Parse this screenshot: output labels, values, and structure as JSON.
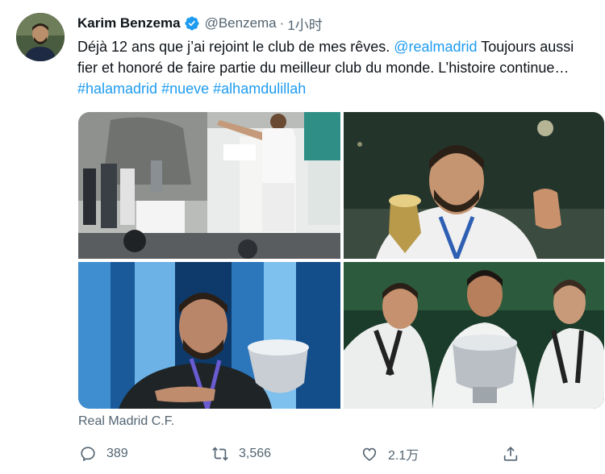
{
  "tweet": {
    "author_name": "Karim Benzema",
    "handle": "@Benzema",
    "separator": "·",
    "time": "1小时",
    "text_parts": [
      {
        "t": "Déjà 12 ans que j’ai rejoint le club de mes rêves. ",
        "link": false
      },
      {
        "t": "@realmadrid",
        "link": true
      },
      {
        "t": " Toujours aussi fier et honoré de faire partie du meilleur club du monde. L’histoire continue… ",
        "link": false
      },
      {
        "t": "#halamadrid",
        "link": true
      },
      {
        "t": " ",
        "link": false
      },
      {
        "t": "#nueve",
        "link": true
      },
      {
        "t": " ",
        "link": false
      },
      {
        "t": "#alhamdulillah",
        "link": true
      }
    ],
    "media_caption": "Real Madrid C.F.",
    "photos": [
      {
        "id": "presentation-photo"
      },
      {
        "id": "trophy-smile-photo"
      },
      {
        "id": "supercup-photo"
      },
      {
        "id": "champions-trio-photo"
      }
    ]
  },
  "actions": {
    "reply_count": "389",
    "retweet_count": "3,566",
    "like_count": "2.1万"
  },
  "colors": {
    "accent": "#1d9bf0",
    "muted": "#536471",
    "text": "#0f1419"
  },
  "icons": {
    "verified": "verified-badge-icon",
    "reply": "reply-icon",
    "retweet": "retweet-icon",
    "like": "heart-icon",
    "share": "share-icon"
  }
}
